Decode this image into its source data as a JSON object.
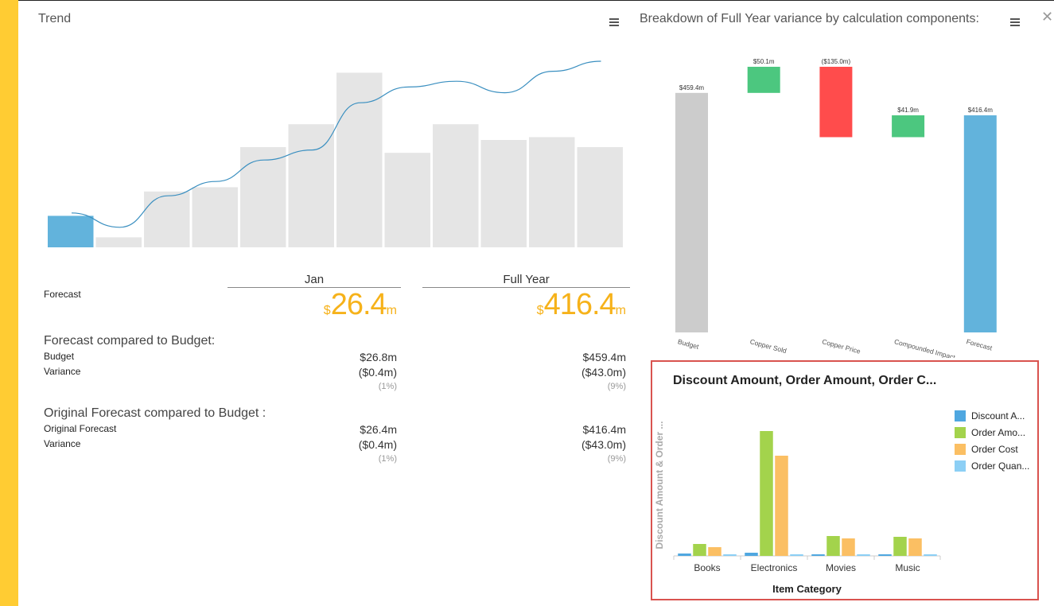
{
  "trend": {
    "title": "Trend",
    "chart_data": {
      "type": "bar",
      "bars": [
        22,
        7,
        39,
        42,
        70,
        86,
        122,
        66,
        86,
        75,
        77,
        70
      ],
      "highlight_index": 0,
      "line": [
        24,
        14,
        36,
        46,
        61,
        68,
        101,
        112,
        116,
        108,
        123,
        130
      ],
      "colors": {
        "highlight": "#62b3dc",
        "bar": "#e5e5e5",
        "line": "#3a8fc0"
      }
    }
  },
  "summary": {
    "row_label_forecast": "Forecast",
    "col_jan": "Jan",
    "col_full_year": "Full Year",
    "jan_value": {
      "currency": "$",
      "number": "26.4",
      "unit": "m"
    },
    "fy_value": {
      "currency": "$",
      "number": "416.4",
      "unit": "m"
    },
    "section1": {
      "title": "Forecast compared to Budget:",
      "label1": "Budget",
      "label2": "Variance",
      "jan_v1": "$26.8m",
      "jan_v2": "($0.4m)",
      "jan_pct": "(1%)",
      "fy_v1": "$459.4m",
      "fy_v2": "($43.0m)",
      "fy_pct": "(9%)"
    },
    "section2": {
      "title": "Original Forecast compared to Budget :",
      "label1": "Original Forecast",
      "label2": "Variance",
      "jan_v1": "$26.4m",
      "jan_v2": "($0.4m)",
      "jan_pct": "(1%)",
      "fy_v1": "$416.4m",
      "fy_v2": "($43.0m)",
      "fy_pct": "(9%)"
    }
  },
  "waterfall": {
    "title": "Breakdown of Full Year variance by calculation components:",
    "chart_data": {
      "type": "bar",
      "categories": [
        "Budget",
        "Copper Sold",
        "Copper Price",
        "Compounded Impact",
        "Forecast"
      ],
      "values": [
        459.4,
        50.1,
        -135.0,
        41.9,
        416.4
      ],
      "labels": [
        "$459.4m",
        "$50.1m",
        "($135.0m)",
        "$41.9m",
        "$416.4m"
      ],
      "colors": [
        "#cccccc",
        "#4cc77f",
        "#ff4c4c",
        "#4cc77f",
        "#62b3dc"
      ]
    }
  },
  "discount_chart": {
    "title": "Discount Amount, Order Amount, Order C...",
    "ylabel": "Discount Amount & Order ...",
    "chart_data": {
      "type": "bar",
      "xlabel": "Item Category",
      "categories": [
        "Books",
        "Electronics",
        "Movies",
        "Music"
      ],
      "series": [
        {
          "name": "Discount A...",
          "color": "#4fa7e0",
          "values": [
            3,
            4,
            2,
            2
          ]
        },
        {
          "name": "Order Amo...",
          "color": "#a3d34c",
          "values": [
            15,
            157,
            25,
            24
          ]
        },
        {
          "name": "Order Cost",
          "color": "#fbbf63",
          "values": [
            11,
            126,
            22,
            22
          ]
        },
        {
          "name": "Order Quan...",
          "color": "#8ccff5",
          "values": [
            2,
            2,
            2,
            2
          ]
        }
      ]
    }
  }
}
